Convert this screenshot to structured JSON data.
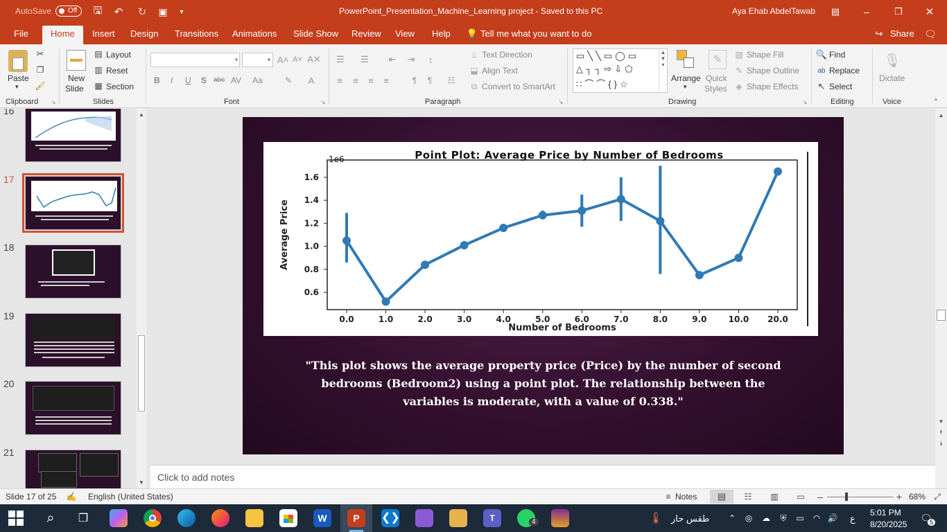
{
  "titlebar": {
    "autosave_label": "AutoSave",
    "autosave_state": "Off",
    "doc_title": "PowerPoint_Presentation_Machine_Learning project  -  Saved to this PC",
    "user_name": "Aya Ehab AbdelTawab"
  },
  "ribbon_tabs": [
    "File",
    "Home",
    "Insert",
    "Design",
    "Transitions",
    "Animations",
    "Slide Show",
    "Review",
    "View",
    "Help"
  ],
  "tell_me": "Tell me what you want to do",
  "share_label": "Share",
  "clipboard": {
    "paste": "Paste",
    "group": "Clipboard"
  },
  "slides_group": {
    "new_slide_1": "New",
    "new_slide_2": "Slide",
    "layout": "Layout",
    "reset": "Reset",
    "section": "Section",
    "group": "Slides"
  },
  "font_group": {
    "bold": "B",
    "italic": "I",
    "underline": "U",
    "shadow": "S",
    "strike": "abc",
    "spacing": "AV",
    "case": "Aa",
    "group": "Font"
  },
  "paragraph_group": {
    "text_direction": "Text Direction",
    "align_text": "Align Text",
    "smartart": "Convert to SmartArt",
    "group": "Paragraph"
  },
  "drawing_group": {
    "arrange": "Arrange",
    "quick_styles_1": "Quick",
    "quick_styles_2": "Styles",
    "shape_fill": "Shape Fill",
    "shape_outline": "Shape Outline",
    "shape_effects": "Shape Effects",
    "group": "Drawing"
  },
  "editing_group": {
    "find": "Find",
    "replace": "Replace",
    "select": "Select",
    "group": "Editing"
  },
  "voice_group": {
    "dictate": "Dictate",
    "group": "Voice"
  },
  "thumbnails": [
    {
      "number": "16",
      "selected": false
    },
    {
      "number": "17",
      "selected": true
    },
    {
      "number": "18",
      "selected": false
    },
    {
      "number": "19",
      "selected": false
    },
    {
      "number": "20",
      "selected": false
    },
    {
      "number": "21",
      "selected": false
    }
  ],
  "slide": {
    "caption": "\"This plot shows the average property price (Price) by the number of second bedrooms (Bedroom2) using a point plot. The relationship between the variables is moderate, with a value of 0.338.\""
  },
  "chart_data": {
    "type": "line",
    "title": "Point Plot: Average Price by Number of Bedrooms",
    "xlabel": "Number of Bedrooms",
    "ylabel": "Average Price",
    "offset_text": "1e6",
    "categories": [
      "0.0",
      "1.0",
      "2.0",
      "3.0",
      "4.0",
      "5.0",
      "6.0",
      "7.0",
      "8.0",
      "9.0",
      "10.0",
      "20.0"
    ],
    "values": [
      1.05,
      0.52,
      0.84,
      1.01,
      1.16,
      1.27,
      1.31,
      1.41,
      1.22,
      0.75,
      0.9,
      1.65
    ],
    "error_low": [
      0.86,
      0.49,
      0.83,
      1.0,
      1.15,
      1.24,
      1.17,
      1.22,
      0.76,
      0.74,
      0.89,
      1.64
    ],
    "error_high": [
      1.29,
      0.55,
      0.85,
      1.02,
      1.17,
      1.31,
      1.45,
      1.6,
      1.7,
      0.76,
      0.91,
      1.66
    ],
    "yticks": [
      "0.6",
      "0.8",
      "1.0",
      "1.2",
      "1.4",
      "1.6"
    ],
    "ylim": [
      0.45,
      1.75
    ],
    "color": "#2f7ab5"
  },
  "notes_placeholder": "Click to add notes",
  "status": {
    "slide_info": "Slide 17 of 25",
    "language": "English (United States)",
    "notes": "Notes",
    "zoom": "68%"
  },
  "taskbar": {
    "weather": "طقس حار",
    "time": "5:01 PM",
    "date": "8/20/2025",
    "lang": "ع",
    "notification_count": "5",
    "whatsapp_badge": "4"
  }
}
